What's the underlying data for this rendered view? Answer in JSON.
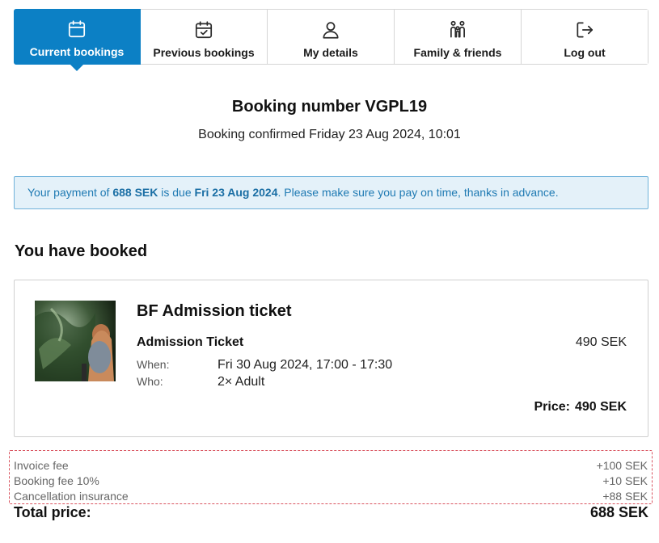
{
  "tabs": [
    {
      "label": "Current bookings",
      "icon": "calendar-icon",
      "active": true
    },
    {
      "label": "Previous bookings",
      "icon": "calendar-check-icon",
      "active": false
    },
    {
      "label": "My details",
      "icon": "user-icon",
      "active": false
    },
    {
      "label": "Family & friends",
      "icon": "family-icon",
      "active": false
    },
    {
      "label": "Log out",
      "icon": "logout-icon",
      "active": false
    }
  ],
  "booking": {
    "number_label": "Booking number VGPL19",
    "confirmed": "Booking confirmed Friday 23 Aug 2024, 10:01"
  },
  "notice": {
    "prefix": "Your payment of ",
    "amount": "688 SEK",
    "middle": " is due ",
    "due_date": "Fri 23 Aug 2024",
    "suffix": ". Please make sure you pay on time, thanks in advance."
  },
  "section_title": "You have booked",
  "item": {
    "title": "BF Admission ticket",
    "ticket_name": "Admission Ticket",
    "ticket_price": "490 SEK",
    "when_label": "When:",
    "when_value": "Fri 30 Aug 2024, 17:00 - 17:30",
    "who_label": "Who:",
    "who_value": "2× Adult",
    "price_label": "Price:",
    "price_value": "490 SEK"
  },
  "fees": [
    {
      "label": "Invoice fee",
      "value": "+100 SEK"
    },
    {
      "label": "Booking fee 10%",
      "value": "+10 SEK"
    },
    {
      "label": "Cancellation insurance",
      "value": "+88 SEK"
    }
  ],
  "total": {
    "label": "Total price:",
    "value": "688 SEK"
  },
  "colors": {
    "accent": "#0c80c5",
    "notice_bg": "#e4f1f9",
    "notice_border": "#6fb2da",
    "fee_highlight": "#d9535f"
  }
}
